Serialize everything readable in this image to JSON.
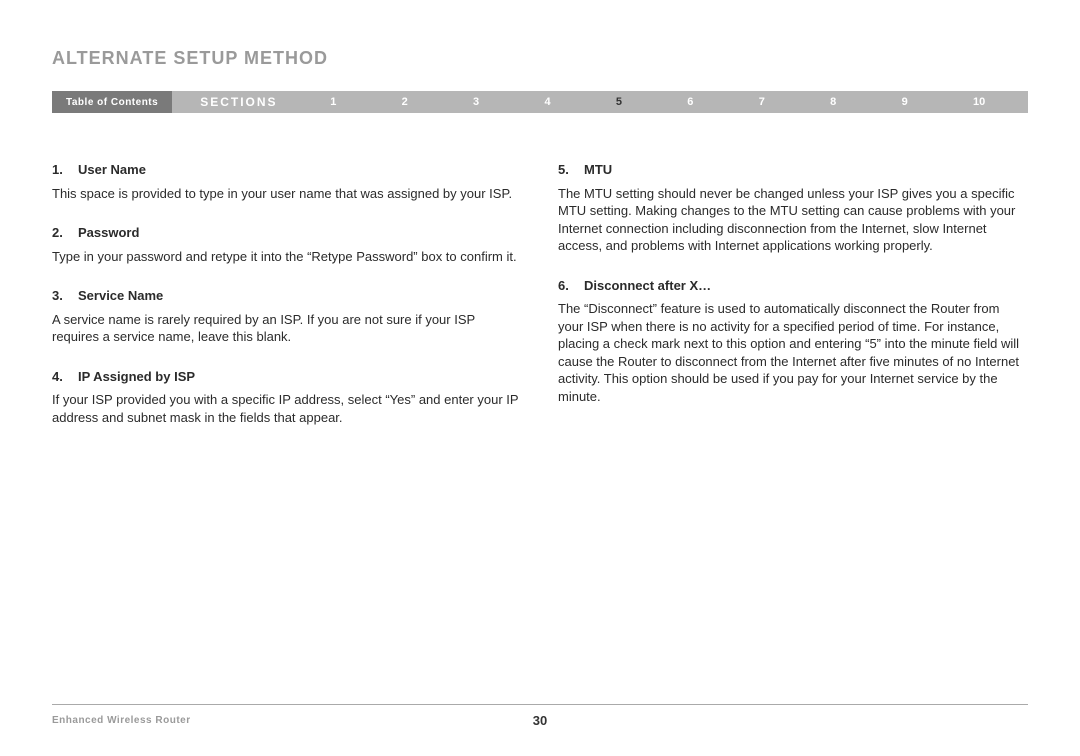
{
  "header": {
    "title": "ALTERNATE SETUP METHOD"
  },
  "nav": {
    "toc_label": "Table of Contents",
    "sections_label": "SECTIONS",
    "numbers": [
      "1",
      "2",
      "3",
      "4",
      "5",
      "6",
      "7",
      "8",
      "9",
      "10"
    ],
    "active": "5"
  },
  "left_column": [
    {
      "num": "1.",
      "title": "User Name",
      "body": "This space is provided to type in your user name that was assigned by your ISP."
    },
    {
      "num": "2.",
      "title": "Password",
      "body": "Type in your password and retype it into the “Retype Password” box to confirm it."
    },
    {
      "num": "3.",
      "title": "Service Name",
      "body": "A service name is rarely required by an ISP. If you are not sure if your ISP requires a service name, leave this blank."
    },
    {
      "num": "4.",
      "title": "IP Assigned by ISP",
      "body": "If your ISP provided you with a specific IP address, select “Yes” and enter your IP address and subnet mask in the fields that appear."
    }
  ],
  "right_column": [
    {
      "num": "5.",
      "title": "MTU",
      "body": "The MTU setting should never be changed unless your ISP gives you a specific MTU setting. Making changes to the MTU setting can cause problems with your Internet connection including disconnection from the Internet, slow Internet access, and problems with Internet applications working properly."
    },
    {
      "num": "6.",
      "title": "Disconnect after X…",
      "body": "The “Disconnect” feature is used to automatically disconnect the Router from your ISP when there is no activity for a specified period of time. For instance, placing a check mark next to this option and entering “5” into the minute field will cause the Router to disconnect from the Internet after five minutes of no Internet activity. This option should be used if you pay for your Internet service by the minute."
    }
  ],
  "footer": {
    "left": "Enhanced Wireless Router",
    "page_number": "30"
  }
}
